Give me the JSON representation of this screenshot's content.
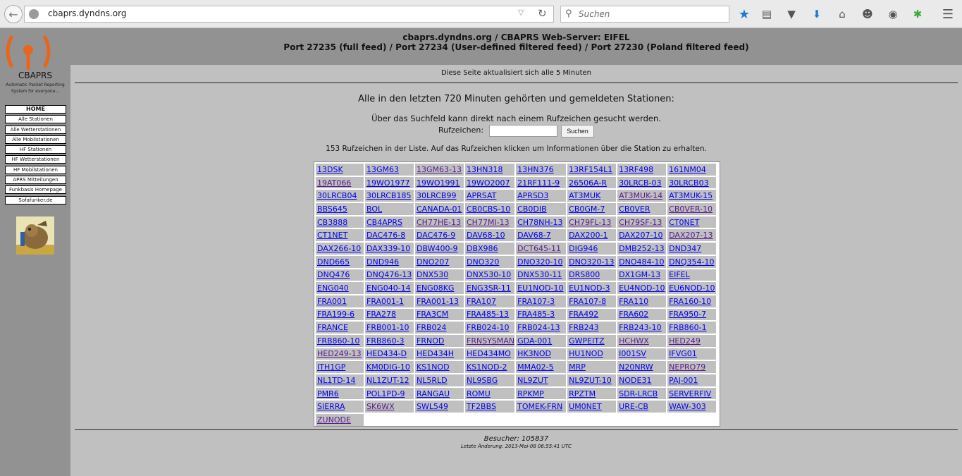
{
  "browser": {
    "url": "cbaprs.dyndns.org",
    "search_placeholder": "Suchen"
  },
  "header": {
    "line1": "cbaprs.dyndns.org / CBAPRS Web-Server: EIFEL",
    "line2": "Port 27235 (full feed) / Port 27234 (User-defined filtered feed) / Port 27230 (Poland filtered feed)"
  },
  "logo": {
    "title": "CBAPRS",
    "subtitle": "Automatic Packet Reporting System for everyone..."
  },
  "nav": [
    "HOME",
    "Alle Stationen",
    "Alle Wetterstationen",
    "Alle Mobilstationen",
    "HF Stationen",
    "HF Wetterstationen",
    "HF Mobilstationen",
    "APRS Mitteilungen",
    "Funkbasis Homepage",
    "Sofafunker.de"
  ],
  "main": {
    "update_note": "Diese Seite aktualisiert sich alle 5 Minuten",
    "heading": "Alle in den letzten 720 Minuten gehörten und gemeldeten Stationen:",
    "search_hint": "Über das Suchfeld kann direkt nach einem Rufzeichen gesucht werden.",
    "call_label": "Rufzeichen:",
    "call_value": "",
    "search_button": "Suchen",
    "count_text": "153 Rufzeichen in der Liste. Auf das Rufzeichen klicken um Informationen über die Station zu erhalten."
  },
  "stations": [
    [
      "13DSK",
      "13GM63",
      "13GM63-13*",
      "13HN318",
      "13HN376",
      "13RF154L1",
      "13RF498",
      "161NM04"
    ],
    [
      "19AT066*",
      "19WO1977",
      "19WO1991",
      "19WO2007",
      "21RF111-9",
      "26506A-R",
      "30LRCB-03",
      "30LRCB03"
    ],
    [
      "30LRCB04",
      "30LRCB185",
      "30LRCB99",
      "APRSAT",
      "APRSD3",
      "AT3MUK",
      "AT3MUK-14*",
      "AT3MUK-15"
    ],
    [
      "BBS645",
      "BOL",
      "CANADA-01",
      "CB0CBS-10",
      "CB0DIB",
      "CB0GM-7",
      "CB0VER",
      "CB0VER-10*"
    ],
    [
      "CB3888",
      "CB4APRS",
      "CH77HE-13*",
      "CH77MI-13*",
      "CH78NH-13",
      "CH79FL-13*",
      "CH79SF-13*",
      "CT0NET"
    ],
    [
      "CT1NET",
      "DAC476-8",
      "DAC476-9",
      "DAV68-10",
      "DAV68-7",
      "DAX200-1",
      "DAX207-10",
      "DAX207-13*"
    ],
    [
      "DAX266-10",
      "DAX339-10",
      "DBW400-9",
      "DBX986",
      "DCT645-11*",
      "DIG946",
      "DMB252-13",
      "DND347"
    ],
    [
      "DND665",
      "DND946",
      "DNO207",
      "DNO320",
      "DNO320-10",
      "DNO320-13",
      "DNO484-10",
      "DNQ354-10"
    ],
    [
      "DNQ476",
      "DNQ476-13",
      "DNX530",
      "DNX530-10",
      "DNX530-11",
      "DRS800",
      "DX1GM-13",
      "EIFEL"
    ],
    [
      "ENG040",
      "ENG040-14",
      "ENG08KG",
      "ENG3SR-11",
      "EU1NOD-10",
      "EU1NOD-3",
      "EU4NOD-10",
      "EU6NOD-10"
    ],
    [
      "FRA001",
      "FRA001-1",
      "FRA001-13",
      "FRA107",
      "FRA107-3",
      "FRA107-8",
      "FRA110",
      "FRA160-10"
    ],
    [
      "FRA199-6",
      "FRA278",
      "FRA3CM",
      "FRA485-13",
      "FRA485-3",
      "FRA492",
      "FRA602",
      "FRA950-7"
    ],
    [
      "FRANCE",
      "FRB001-10",
      "FRB024",
      "FRB024-10",
      "FRB024-13",
      "FRB243",
      "FRB243-10",
      "FRB860-1"
    ],
    [
      "FRB860-10",
      "FRB860-3",
      "FRNOD",
      "FRNSYSMAN*",
      "GDA-001",
      "GWPEITZ",
      "HCHWX*",
      "HED249*"
    ],
    [
      "HED249-13*",
      "HED434-D",
      "HED434H",
      "HED434MO",
      "HK3NOD",
      "HU1NOD",
      "I001SV",
      "IFVG01"
    ],
    [
      "ITH1GP",
      "KM0DIG-10",
      "KS1NOD",
      "KS1NOD-2",
      "MMA02-5",
      "MRP",
      "N20NRW",
      "NEPRO79*"
    ],
    [
      "NL1TD-14",
      "NL1ZUT-12",
      "NL5RLD",
      "NL9SBG",
      "NL9ZUT",
      "NL9ZUT-10",
      "NODE31",
      "PAJ-001"
    ],
    [
      "PMR6",
      "POL1PD-9",
      "RANGAU",
      "ROMU",
      "RPKMP",
      "RPZTM",
      "SDR-LRCB",
      "SERVERFIV"
    ],
    [
      "SIERRA",
      "SK6WX*",
      "SWL549",
      "TF2BBS",
      "TOMEK-FRN",
      "UM0NET",
      "URE-CB",
      "WAW-303"
    ],
    [
      "ZUNODE*"
    ]
  ],
  "footer": {
    "visitors": "Besucher: 105837",
    "last_change": "Letzte Änderung: 2013-Mai-08 06:55:41 UTC"
  }
}
